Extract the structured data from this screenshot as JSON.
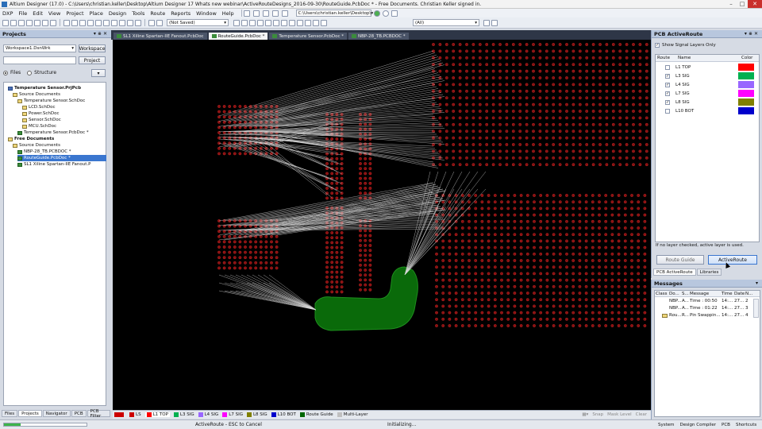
{
  "titlebar": {
    "text": "Altium Designer (17.0) - C:\\Users\\christian.keller\\Desktop\\Altium Designer 17 Whats new webinar\\ActiveRouteDesigns_2016-09-30\\RouteGuide.PcbDoc * - Free Documents. Christian Keller signed in."
  },
  "menu": [
    "DXP",
    "File",
    "Edit",
    "View",
    "Project",
    "Place",
    "Design",
    "Tools",
    "Route",
    "Reports",
    "Window",
    "Help"
  ],
  "toolbar": {
    "path_value": "C:\\Users\\christian.keller\\Desktop\\",
    "save_state": "(Not Saved)",
    "filter_value": "(All)"
  },
  "projects_panel": {
    "title": "Projects",
    "workspace_value": "Workspace1.DsnWrk",
    "workspace_button": "Workspace",
    "project_button": "Project",
    "view_files": "Files",
    "view_structure": "Structure",
    "tree": [
      {
        "label": "Temperature Sensor.PrjPcb",
        "level": 0,
        "type": "prj",
        "bold": true,
        "sel": false
      },
      {
        "label": "Source Documents",
        "level": 1,
        "type": "folder",
        "bold": false,
        "sel": false
      },
      {
        "label": "Temperature Sensor.SchDoc",
        "level": 2,
        "type": "folder",
        "bold": false,
        "sel": false
      },
      {
        "label": "LCD.SchDoc",
        "level": 3,
        "type": "sch",
        "bold": false,
        "sel": false
      },
      {
        "label": "Power.SchDoc",
        "level": 3,
        "type": "sch",
        "bold": false,
        "sel": false
      },
      {
        "label": "Sensor.SchDoc",
        "level": 3,
        "type": "sch",
        "bold": false,
        "sel": false
      },
      {
        "label": "MCU.SchDoc",
        "level": 3,
        "type": "sch",
        "bold": false,
        "sel": false
      },
      {
        "label": "Temperature Sensor.PcbDoc *",
        "level": 2,
        "type": "pcb",
        "bold": false,
        "sel": false
      },
      {
        "label": "Free Documents",
        "level": 0,
        "type": "folder",
        "bold": true,
        "sel": false
      },
      {
        "label": "Source Documents",
        "level": 1,
        "type": "folder",
        "bold": false,
        "sel": false
      },
      {
        "label": "NBP-28_TB.PCBDOC *",
        "level": 2,
        "type": "pcb",
        "bold": false,
        "sel": false
      },
      {
        "label": "RouteGuide.PcbDoc *",
        "level": 2,
        "type": "pcb",
        "bold": false,
        "sel": true
      },
      {
        "label": "SL1 Xiline Spartan-IIE Fanout.P",
        "level": 2,
        "type": "pcb",
        "bold": false,
        "sel": false
      }
    ],
    "bottom_tabs": [
      "Files",
      "Projects",
      "Navigator",
      "PCB",
      "PCB Filter"
    ]
  },
  "doc_tabs": [
    {
      "label": "SL1 Xiline Spartan-IIE Fanout.PcbDoc",
      "active": false
    },
    {
      "label": "RouteGuide.PcbDoc *",
      "active": true
    },
    {
      "label": "Temperature Sensor.PcbDoc *",
      "active": false
    },
    {
      "label": "NBP-28_TB.PCBDOC *",
      "active": false
    }
  ],
  "layer_tabs": [
    {
      "label": "LS",
      "color": "#cc0000"
    },
    {
      "label": "L1 TOP",
      "color": "#ff0000",
      "active": true
    },
    {
      "label": "L3 SIG",
      "color": "#00b050"
    },
    {
      "label": "L4 SIG",
      "color": "#9966ff"
    },
    {
      "label": "L7 SIG",
      "color": "#ff00ff"
    },
    {
      "label": "L8 SIG",
      "color": "#808000"
    },
    {
      "label": "L10 BOT",
      "color": "#0000cc"
    },
    {
      "label": "Route Guide",
      "color": "#006600"
    },
    {
      "label": "Multi-Layer",
      "color": "#c0c0c0"
    }
  ],
  "layer_tabs_right": [
    "Snap",
    "Mask Level",
    "Clear"
  ],
  "activeroute_panel": {
    "title": "PCB ActiveRoute",
    "show_signal_layers": "Show Signal Layers Only",
    "col_route": "Route",
    "col_name": "Name",
    "col_color": "Color",
    "layers": [
      {
        "name": "L1 TOP",
        "checked": false,
        "color": "#ff0000"
      },
      {
        "name": "L3 SIG",
        "checked": true,
        "color": "#00b050"
      },
      {
        "name": "L4 SIG",
        "checked": true,
        "color": "#9966ff"
      },
      {
        "name": "L7 SIG",
        "checked": true,
        "color": "#ff00ff"
      },
      {
        "name": "L8 SIG",
        "checked": true,
        "color": "#808000"
      },
      {
        "name": "L10 BOT",
        "checked": false,
        "color": "#0000cc"
      }
    ],
    "note": "If no layer checked, active layer is used.",
    "route_guide_button": "Route Guide",
    "activeroute_button": "ActiveRoute",
    "tabs": [
      "PCB ActiveRoute",
      "Libraries"
    ]
  },
  "messages_panel": {
    "title": "Messages",
    "columns": [
      "Class",
      "Do...",
      "S...",
      "Message",
      "Time",
      "Date",
      "N..."
    ],
    "rows": [
      {
        "doc": "NBP...",
        "src": "A...",
        "msg": "Time : 00:50",
        "time": "14:...",
        "date": "27...",
        "n": "2"
      },
      {
        "doc": "NBP...",
        "src": "A...",
        "msg": "Time : 01:22",
        "time": "14:...",
        "date": "27...",
        "n": "3"
      },
      {
        "doc": "Rou...",
        "src": "R...",
        "msg": "Pin Swappin...",
        "time": "14:...",
        "date": "27...",
        "n": "4"
      }
    ]
  },
  "statusbar": {
    "activeroute": "ActiveRoute - ESC to Cancel",
    "initializing": "Initializing...",
    "right_items": [
      "System",
      "Design Compiler",
      "PCB",
      "Shortcuts"
    ]
  }
}
